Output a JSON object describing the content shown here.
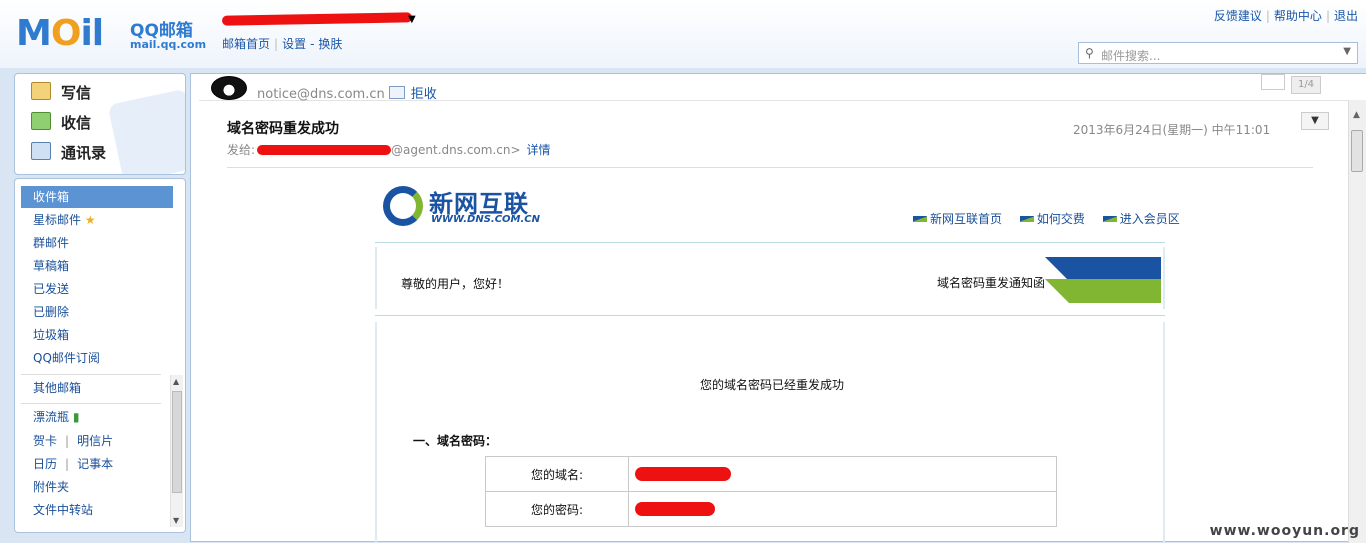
{
  "app": {
    "brand_logo": "MOil",
    "brand_name": "QQ邮箱",
    "brand_domain": "mail.qq.com"
  },
  "header": {
    "nav": [
      "邮箱首页",
      "设置",
      "换肤"
    ],
    "nav_dash": "-",
    "links": [
      "反馈建议",
      "帮助中心",
      "退出"
    ],
    "search_placeholder": "邮件搜索..."
  },
  "compose": {
    "write": "写信",
    "receive": "收信",
    "contacts": "通讯录"
  },
  "folders": {
    "items": [
      "收件箱",
      "星标邮件",
      "群邮件",
      "草稿箱",
      "已发送",
      "已删除",
      "垃圾箱",
      "QQ邮件订阅"
    ],
    "other": "其他邮箱",
    "apps": [
      "漂流瓶",
      "贺卡",
      "明信片",
      "日历",
      "记事本",
      "附件夹",
      "文件中转站"
    ],
    "active_index": 0
  },
  "message": {
    "sender_email": "notice@dns.com.cn",
    "reject_label": "拒收",
    "page_indicator": "1/4",
    "subject": "域名密码重发成功",
    "datetime": "2013年6月24日(星期一) 中午11:01",
    "from_label": "发给:",
    "to_suffix": "@agent.dns.com.cn>",
    "details_link": "详情"
  },
  "email_body": {
    "brand_name": "新网互联",
    "brand_url": "WWW.DNS.COM.CN",
    "nav": [
      "新网互联首页",
      "如何交费",
      "进入会员区"
    ],
    "greeting": "尊敬的用户，您好！",
    "notice_title": "域名密码重发通知函",
    "success_msg": "您的域名密码已经重发成功",
    "section_title": "一、域名密码：",
    "rows": [
      {
        "label": "您的域名:"
      },
      {
        "label": "您的密码:"
      }
    ]
  },
  "watermark": "www.wooyun.org",
  "colors": {
    "accent": "#2f7bd0",
    "active_folder": "#5b93d3",
    "link": "#1a56a8",
    "redaction": "#ee1111",
    "dns_blue": "#1a53a2",
    "dns_green": "#80b631"
  }
}
